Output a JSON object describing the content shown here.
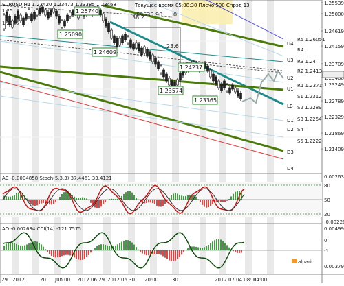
{
  "header": {
    "symbol_info": "EURUSD,H1  1.23420 1.23473 1.23385 1.23468",
    "status_line": "Текущее время 05:08:30  Плечо 500  Спрэд 13",
    "balance": "69635.90",
    "zero_label": "0"
  },
  "main_chart": {
    "small_labels": [
      "1.25",
      "1.2376"
    ],
    "price_boxes": [
      "1.25740",
      "1.25090",
      "1.24609",
      "1.24237",
      "1.23574",
      "1.23365"
    ],
    "level_23_6": "23.6",
    "level_38_2": "38.2",
    "pivot_labels": [
      "U4",
      "U3",
      "U2",
      "U1",
      "LB",
      "D1",
      "D2",
      "D3",
      "D4"
    ],
    "ghost_pivot_labels": [
      "R5 1.26051",
      "R4",
      "R3 1.24",
      "R2 1.2413",
      "R1 1.2371",
      "S1 1.2312",
      "S2 1.2289",
      "S3 1.2254",
      "S4",
      "S5 1.2222"
    ],
    "price_axis": [
      "1.25539",
      "1.25000",
      "1.24619",
      "1.24159",
      "1.23709",
      "1.23468",
      "1.23249",
      "1.22789",
      "1.22329",
      "1.21869",
      "1.21409"
    ]
  },
  "ac_panel": {
    "label": "AC -0.0004858  Stoch(5,3,3) 37.4461 33.4121",
    "axis": [
      "0.00263",
      "80",
      "50",
      "20",
      "-0.00228"
    ]
  },
  "ao_panel": {
    "label": "AO -0.002634  CCI(14) -121.7575",
    "axis": [
      "0.004990",
      "0",
      "-1",
      "0.003790"
    ],
    "brand": "alpari"
  },
  "time_axis": [
    "29",
    "2012",
    "20",
    "Jun 00",
    "2012.06.29",
    "2012.06.30",
    "20:00",
    "30",
    "2012.07.04 08:00",
    "04:00"
  ],
  "colors": {
    "pivot_dark": "#4a7a0a",
    "pivot_teal": "#1f8a8a",
    "pivot_blue": "#5555dd",
    "red_line": "#e03a3a",
    "highlight": "#fbeeb0",
    "osc_red": "#cc1111",
    "osc_green": "#117711"
  }
}
